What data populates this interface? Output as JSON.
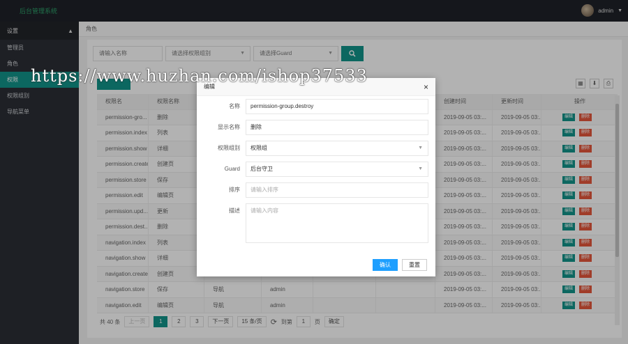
{
  "app": {
    "brand": "后台管理系统",
    "user": "admin"
  },
  "sidebar": {
    "section": "设置",
    "items": [
      {
        "label": "管理员",
        "active": false
      },
      {
        "label": "角色",
        "active": false
      },
      {
        "label": "权限",
        "active": true
      },
      {
        "label": "权限组别",
        "active": false
      },
      {
        "label": "导航菜单",
        "active": false
      }
    ]
  },
  "breadcrumb": "角色",
  "filters": {
    "name_placeholder": "请输入名称",
    "group_placeholder": "请选择权限组别",
    "guard_placeholder": "请选择Guard"
  },
  "table": {
    "headers": [
      "权限名",
      "权限名称",
      "",
      "",
      "",
      "",
      "创建时间",
      "更新时间",
      "操作"
    ],
    "edit_label": "编辑",
    "delete_label": "删除",
    "rows": [
      [
        "permission-gro...",
        "删除",
        "",
        "",
        "",
        "",
        "2019-09-05 03:...",
        "2019-09-05 03:..."
      ],
      [
        "permission.index",
        "列表",
        "",
        "",
        "",
        "",
        "2019-09-05 03:...",
        "2019-09-05 03:..."
      ],
      [
        "permission.show",
        "详细",
        "",
        "",
        "",
        "",
        "2019-09-05 03:...",
        "2019-09-05 03:..."
      ],
      [
        "permission.create",
        "创建页",
        "",
        "",
        "",
        "",
        "2019-09-05 03:...",
        "2019-09-05 03:..."
      ],
      [
        "permission.store",
        "保存",
        "",
        "",
        "",
        "",
        "2019-09-05 03:...",
        "2019-09-05 03:..."
      ],
      [
        "permission.edit",
        "编辑页",
        "",
        "",
        "",
        "",
        "2019-09-05 03:...",
        "2019-09-05 03:..."
      ],
      [
        "permission.upd...",
        "更新",
        "",
        "",
        "",
        "",
        "2019-09-05 03:...",
        "2019-09-05 03:..."
      ],
      [
        "permission.dest...",
        "删除",
        "",
        "",
        "",
        "",
        "2019-09-05 03:...",
        "2019-09-05 03:..."
      ],
      [
        "navigation.index",
        "列表",
        "",
        "",
        "",
        "",
        "2019-09-05 03:...",
        "2019-09-05 03:..."
      ],
      [
        "navigation.show",
        "详细",
        "",
        "",
        "",
        "",
        "2019-09-05 03:...",
        "2019-09-05 03:..."
      ],
      [
        "navigation.create",
        "创建页",
        "",
        "",
        "",
        "",
        "2019-09-05 03:...",
        "2019-09-05 03:..."
      ],
      [
        "navigation.store",
        "保存",
        "导航",
        "admin",
        "",
        "",
        "2019-09-05 03:...",
        "2019-09-05 03:..."
      ],
      [
        "navigation.edit",
        "编辑页",
        "导航",
        "admin",
        "",
        "",
        "2019-09-05 03:...",
        "2019-09-05 03:..."
      ]
    ]
  },
  "pager": {
    "total": "共 40 条",
    "prev": "上一页",
    "pages": [
      "1",
      "2",
      "3"
    ],
    "next": "下一页",
    "page_size": "15 条/页",
    "goto_label": "到第",
    "goto_value": "1",
    "page_unit": "页",
    "confirm": "确定"
  },
  "modal": {
    "title": "编辑",
    "fields": {
      "name_label": "名称",
      "name_value": "permission-group.destroy",
      "display_label": "显示名称",
      "display_value": "删除",
      "group_label": "权限组别",
      "group_value": "权限组",
      "guard_label": "Guard",
      "guard_value": "后台守卫",
      "sort_label": "排序",
      "sort_placeholder": "请输入排序",
      "desc_label": "描述",
      "desc_placeholder": "请输入内容"
    },
    "ok": "确认",
    "reset": "重置"
  },
  "watermark": "https://www.huzhan.com/ishop37533",
  "colors": {
    "accent": "#12948a",
    "danger": "#e5573b",
    "primary": "#1e9fff",
    "topbar": "#1f2229",
    "sidebar": "#2b2e35"
  }
}
